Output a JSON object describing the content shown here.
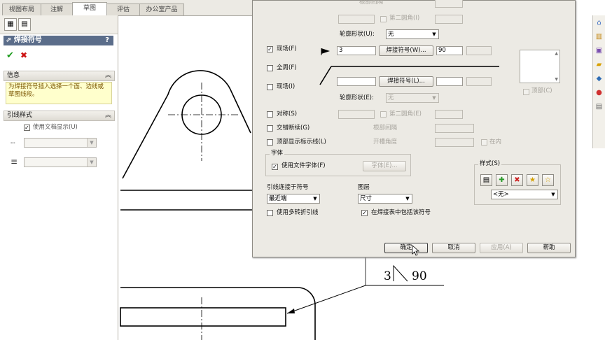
{
  "tabs": [
    "视图布局",
    "注解",
    "草图",
    "评估",
    "办公室产品"
  ],
  "active_tab": 2,
  "property_manager": {
    "title": "焊接符号",
    "help": "?",
    "ok_icon": "✔",
    "cancel_icon": "✖",
    "info_header": "信息",
    "info_text": "为焊接符号插入选择一个面、边线或草图线段。",
    "leader_header": "引线样式",
    "use_doc_display": "使用文档显示(U)",
    "collapse": "︽"
  },
  "dialog": {
    "top_label_partial": "根部间隔",
    "second_fillet_top": "第二圆角(I)",
    "contour_top_label": "轮廓形状(U):",
    "contour_top_value": "无",
    "field_site_top": "现场(F)",
    "all_around": "全周(F)",
    "field_site_bottom": "现场(I)",
    "weld_symbol_top_btn": "焊接符号(W)...",
    "weld_symbol_bottom_btn": "焊接符号(L)...",
    "left_value": "3",
    "right_value": "90",
    "contour_bottom_label": "轮廓形状(E):",
    "contour_bottom_value": "无",
    "symmetric": "对称(S)",
    "second_fillet_bottom": "第二圆角(E)",
    "stagger": "交错断续(G)",
    "root_gap": "根部间隔",
    "top_show_id": "顶部显示标示线(L)",
    "groove_angle": "开槽角度",
    "inside": "在内",
    "top_right_label": "顶部(C)",
    "font_group": "字体",
    "use_doc_font": "使用文件字体(F)",
    "font_btn": "字体(E)...",
    "leader_anchor_label": "引线连接于符号",
    "leader_anchor_value": "最近端",
    "layer_label": "图层",
    "layer_value": "尺寸",
    "multi_jog": "使用多转折引线",
    "include_in_table": "在焊接表中包括该符号",
    "style_group": "样式(S)",
    "style_value": "<无>",
    "ok": "确定",
    "cancel": "取消",
    "apply": "应用(A)",
    "help": "帮助"
  },
  "drawing": {
    "weld_left": "3",
    "weld_right": "90"
  },
  "colors": {
    "accent_title": "#5b6d8a",
    "info_bg": "#ffffcc",
    "ok_green": "#1a9a1a",
    "cancel_red": "#cc1111",
    "dialog_bg": "#eceae4"
  }
}
